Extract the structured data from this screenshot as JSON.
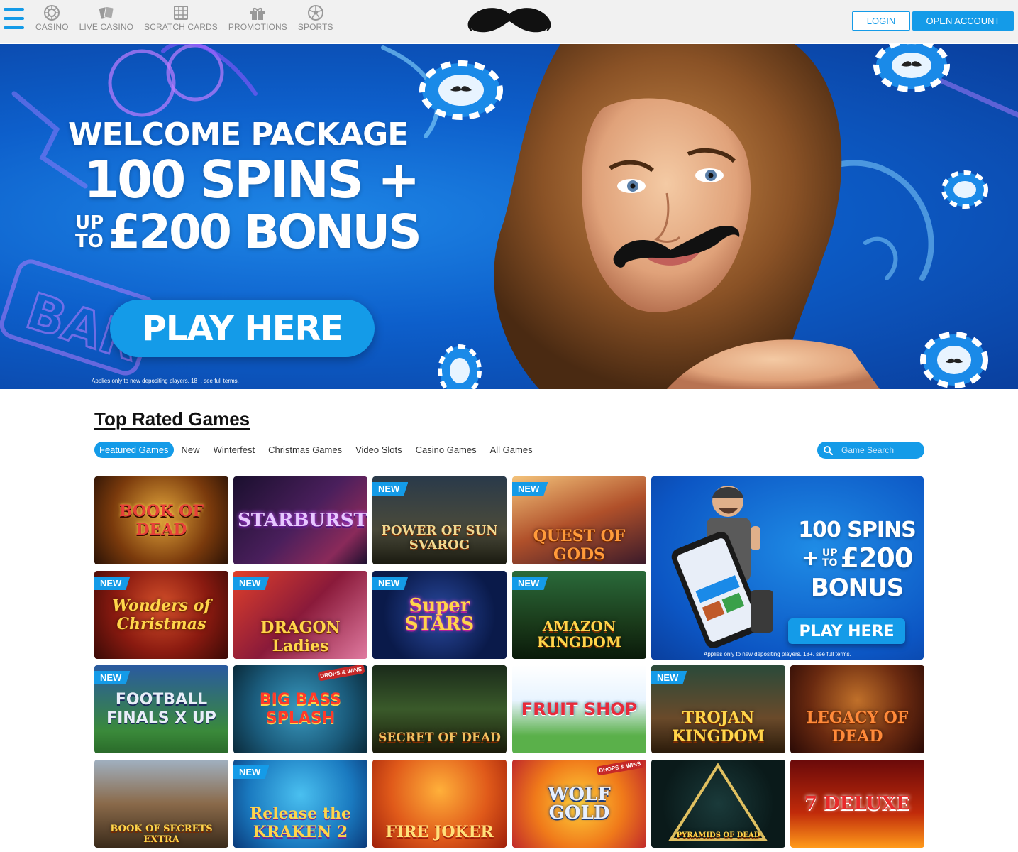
{
  "header": {
    "nav": [
      {
        "label": "CASINO",
        "icon": "casino-chip-icon"
      },
      {
        "label": "LIVE CASINO",
        "icon": "cards-icon"
      },
      {
        "label": "SCRATCH CARDS",
        "icon": "scratch-card-icon"
      },
      {
        "label": "PROMOTIONS",
        "icon": "gift-icon"
      },
      {
        "label": "SPORTS",
        "icon": "football-icon"
      }
    ],
    "login_label": "LOGIN",
    "open_account_label": "OPEN ACCOUNT",
    "accent_color": "#149be8"
  },
  "hero": {
    "line1": "WELCOME PACKAGE",
    "line2": "100 SPINS +",
    "up": "UP",
    "to": "TO",
    "amount": "£200 BONUS",
    "cta": "PLAY HERE",
    "terms": "Applies only to new depositing players. 18+. see full terms."
  },
  "games_section": {
    "title": "Top Rated Games",
    "tabs": [
      "Featured Games",
      "New",
      "Winterfest",
      "Christmas Games",
      "Video Slots",
      "Casino Games",
      "All Games"
    ],
    "active_tab": "Featured Games",
    "search_placeholder": "Game Search"
  },
  "tiles": [
    {
      "name": "BOOK OF DEAD",
      "new": ""
    },
    {
      "name": "STARBURST",
      "new": ""
    },
    {
      "name": "POWER OF SUN SVAROG",
      "new": "NEW"
    },
    {
      "name": "QUEST OF GODS",
      "new": "NEW"
    },
    {
      "name": "Wonders of Christmas",
      "new": "NEW"
    },
    {
      "name": "DRAGON Ladies",
      "new": "NEW"
    },
    {
      "name": "Super STARS",
      "new": "NEW"
    },
    {
      "name": "AMAZON KINGDOM",
      "new": "NEW"
    },
    {
      "name": "FOOTBALL FINALS X UP",
      "new": "NEW"
    },
    {
      "name": "BIG BASS SPLASH",
      "new": "",
      "drops": "DROPS & WINS"
    },
    {
      "name": "SECRET OF DEAD",
      "new": ""
    },
    {
      "name": "FRUIT SHOP",
      "new": ""
    },
    {
      "name": "TROJAN KINGDOM",
      "new": "NEW"
    },
    {
      "name": "LEGACY OF DEAD",
      "new": ""
    },
    {
      "name": "BOOK OF SECRETS EXTRA",
      "new": ""
    },
    {
      "name": "Release the KRAKEN 2",
      "new": "NEW"
    },
    {
      "name": "FIRE JOKER",
      "new": ""
    },
    {
      "name": "WOLF GOLD",
      "new": "",
      "drops": "DROPS & WINS"
    },
    {
      "name": "PYRAMIDS OF DEAD",
      "new": ""
    },
    {
      "name": "7 DELUXE",
      "new": ""
    }
  ],
  "promo": {
    "line1": "100 SPINS",
    "plus": "+",
    "up": "UP",
    "to": "TO",
    "amount": "£200",
    "line3": "BONUS",
    "cta": "PLAY HERE",
    "terms": "Applies only to new depositing players. 18+. see full terms."
  }
}
